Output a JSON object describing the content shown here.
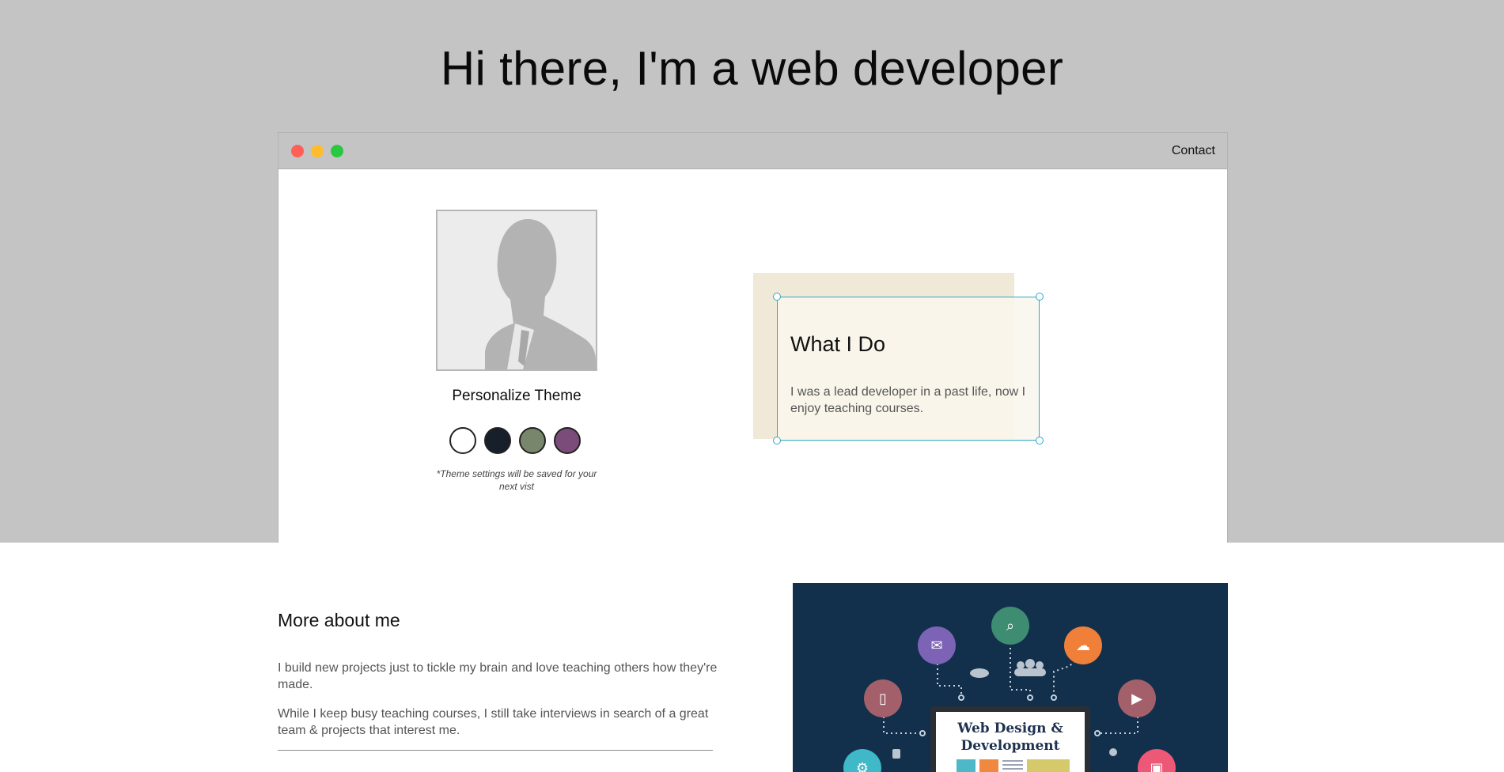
{
  "hero": {
    "title": "Hi there, I'm a web developer"
  },
  "browser": {
    "nav_contact": "Contact"
  },
  "profile": {
    "theme_title": "Personalize Theme",
    "theme_note": "*Theme settings will be saved for your next vist",
    "themes": [
      {
        "name": "light",
        "color": "#ffffff"
      },
      {
        "name": "dark-blue",
        "color": "#17202a"
      },
      {
        "name": "green",
        "color": "#78866b"
      },
      {
        "name": "purple",
        "color": "#7b4c7a"
      }
    ]
  },
  "what_i_do": {
    "title": "What I Do",
    "text": "I was a lead developer in a past life, now I enjoy teaching courses."
  },
  "about": {
    "title": "More about me",
    "paragraph1": "I build new projects just to tickle my brain and love teaching others how they're made.",
    "paragraph2": "While I keep busy teaching courses, I still take interviews in search of a great team & projects that interest me."
  },
  "image": {
    "caption": "Web Design & Development"
  },
  "colors": {
    "greeting_bg": "#c4c4c4",
    "accent_border": "#2ea9c2",
    "image_bg": "#12304c"
  }
}
